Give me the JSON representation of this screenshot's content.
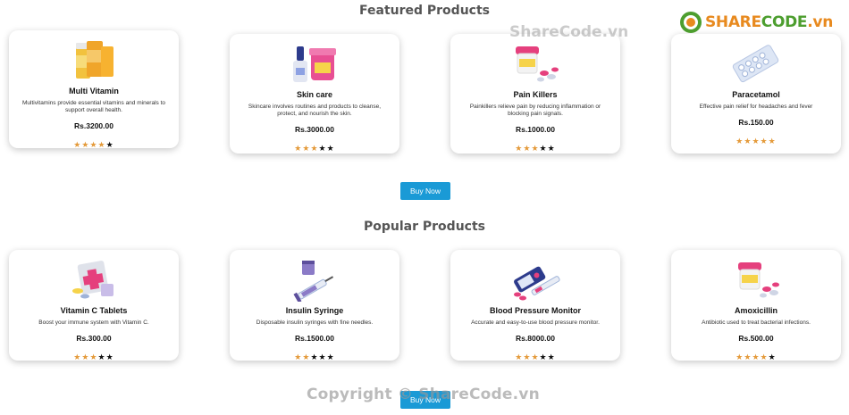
{
  "featured": {
    "title": "Featured Products",
    "products": [
      {
        "name": "Multi Vitamin",
        "desc": "Multivitamins provide essential vitamins and minerals to support overall health.",
        "price": "Rs.3200.00",
        "rating": 4,
        "stars": 5,
        "icon": "vitamin-bottles-icon"
      },
      {
        "name": "Skin care",
        "desc": "Skincare involves routines and products to cleanse, protect, and nourish the skin.",
        "price": "Rs.3000.00",
        "rating": 3,
        "stars": 5,
        "icon": "skincare-bottles-icon"
      },
      {
        "name": "Pain Killers",
        "desc": "Painkillers relieve pain by reducing inflammation or blocking pain signals.",
        "price": "Rs.1000.00",
        "rating": 3,
        "stars": 5,
        "icon": "pill-jar-icon"
      },
      {
        "name": "Paracetamol",
        "desc": "Effective pain relief for headaches and fever",
        "price": "Rs.150.00",
        "rating": 5,
        "stars": 5,
        "icon": "blister-pack-icon"
      }
    ],
    "button": "Buy Now"
  },
  "popular": {
    "title": "Popular Products",
    "products": [
      {
        "name": "Vitamin C Tablets",
        "desc": "Boost your immune system with Vitamin C.",
        "price": "Rs.300.00",
        "rating": 3,
        "stars": 5,
        "icon": "first-aid-kit-icon"
      },
      {
        "name": "Insulin Syringe",
        "desc": "Disposable insulin syringes with fine needles.",
        "price": "Rs.1500.00",
        "rating": 2,
        "stars": 5,
        "icon": "syringe-icon"
      },
      {
        "name": "Blood Pressure Monitor",
        "desc": "Accurate and easy-to-use blood pressure monitor.",
        "price": "Rs.8000.00",
        "rating": 3,
        "stars": 5,
        "icon": "glucometer-icon"
      },
      {
        "name": "Amoxicillin",
        "desc": "Antibiotic used to treat bacterial infections.",
        "price": "Rs.500.00",
        "rating": 4,
        "stars": 5,
        "icon": "pill-jar-icon"
      }
    ],
    "button": "Buy Now"
  },
  "logo": {
    "part1": "SHARE",
    "part2": "CODE",
    "suffix": ".vn"
  },
  "watermark_top": "ShareCode.vn",
  "watermark_bottom": "Copyright © ShareCode.vn",
  "colors": {
    "star": "#e49a3a",
    "button": "#1a9ad6",
    "title": "#555555"
  }
}
